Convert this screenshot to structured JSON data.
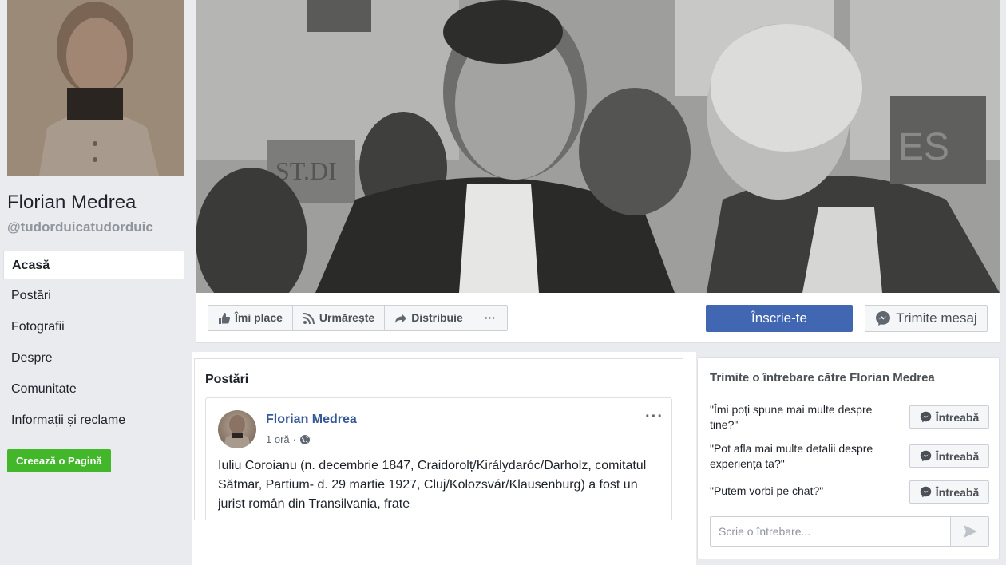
{
  "sidebar": {
    "page_name": "Florian Medrea",
    "page_handle": "@tudorduicatudorduic",
    "nav_items": [
      {
        "label": "Acasă",
        "active": true
      },
      {
        "label": "Postări"
      },
      {
        "label": "Fotografii"
      },
      {
        "label": "Despre"
      },
      {
        "label": "Comunitate"
      },
      {
        "label": "Informații și reclame"
      }
    ],
    "create_page_label": "Creează o Pagină"
  },
  "cover": {
    "image": "vintage black-and-white photo of men in suits",
    "sign_text": "ST.DI"
  },
  "actions": {
    "like_label": "Îmi place",
    "follow_label": "Urmărește",
    "share_label": "Distribuie",
    "more_label": "···",
    "join_label": "Înscrie-te",
    "message_label": "Trimite mesaj"
  },
  "posts": {
    "title": "Postări",
    "items": [
      {
        "author": "Florian Medrea",
        "time": "1 oră",
        "privacy_icon": "globe-icon",
        "more": "···",
        "text": "Iuliu Coroianu (n. decembrie 1847, Craidorolț/Királydaróc/Darholz, comitatul Sătmar, Partium- d. 29 martie 1927, Cluj/Kolozsvár/Klausenburg) a fost un jurist român din Transilvania, frate"
      }
    ]
  },
  "ask": {
    "title": "Trimite o întrebare către Florian Medrea",
    "questions": [
      {
        "text": "\"Îmi poți spune mai multe despre tine?\"",
        "button": "Întreabă"
      },
      {
        "text": "\"Pot afla mai multe detalii despre experiența ta?\"",
        "button": "Întreabă"
      },
      {
        "text": "\"Putem vorbi pe chat?\"",
        "button": "Întreabă"
      }
    ],
    "input_placeholder": "Scrie o întrebare..."
  },
  "colors": {
    "primary": "#4267b2",
    "link": "#365899",
    "green": "#42b72a",
    "background": "#e9ebee"
  }
}
